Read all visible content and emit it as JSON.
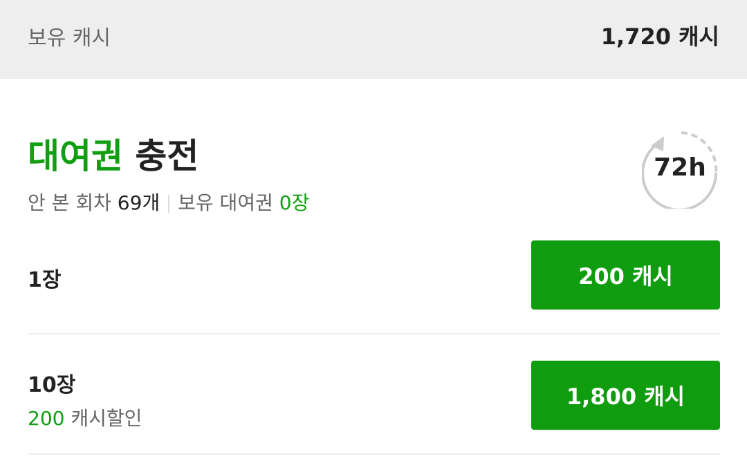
{
  "balance": {
    "label": "보유 캐시",
    "value": "1,720 캐시"
  },
  "header": {
    "title_accent": "대여권",
    "title_rest": " 충전",
    "unread_label": "안 본 회차",
    "unread_count": "69개",
    "owned_label": "보유 대여권",
    "owned_count": "0장"
  },
  "timer": {
    "label": "72h",
    "icon": "72h-timer-icon"
  },
  "options": [
    {
      "quantity": "1장",
      "price": "200 캐시"
    },
    {
      "quantity": "10장",
      "discount_amount": "200",
      "discount_label": " 캐시할인",
      "price": "1,800 캐시"
    }
  ],
  "colors": {
    "accent_green": "#119e11",
    "button_green": "#0f9c0f",
    "balance_bar_bg": "#eeeeee"
  }
}
